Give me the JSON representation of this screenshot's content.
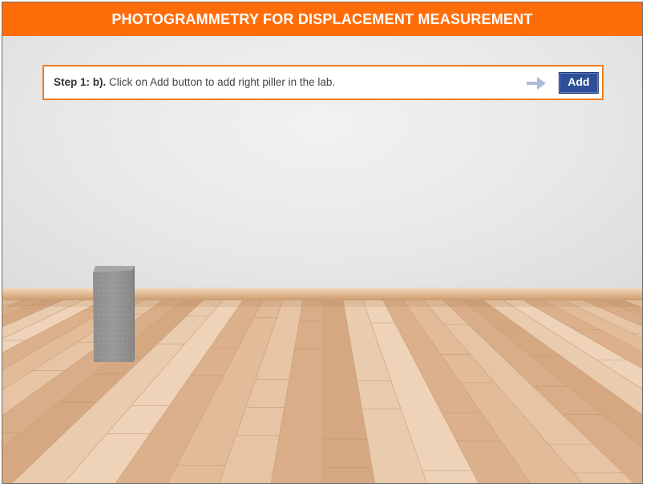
{
  "header": {
    "title": "PHOTOGRAMMETRY FOR DISPLACEMENT MEASUREMENT"
  },
  "instruction": {
    "step_label": "Step 1: b).",
    "text": " Click on Add button to add right piller in the lab.",
    "arrow_icon": "arrow-right-icon"
  },
  "toolbar": {
    "add_label": "Add"
  },
  "scene": {
    "objects": [
      "left-pillar"
    ]
  },
  "colors": {
    "header_bg": "#ff6d0a",
    "step_border": "#f07a1e",
    "button_bg": "#2d4f98",
    "arrow": "#aebbd6"
  }
}
